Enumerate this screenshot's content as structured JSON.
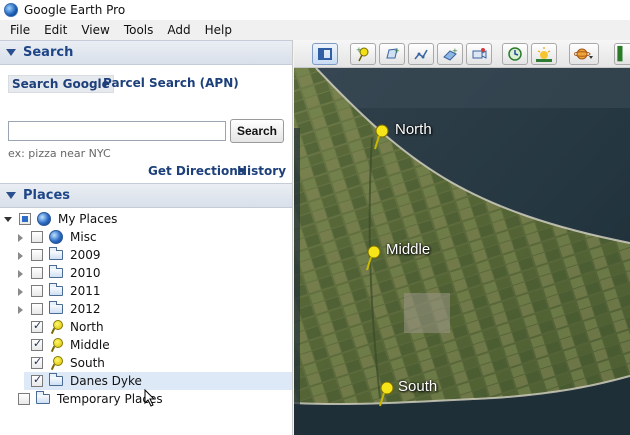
{
  "window": {
    "title": "Google Earth Pro"
  },
  "menu": [
    "File",
    "Edit",
    "View",
    "Tools",
    "Add",
    "Help"
  ],
  "search_panel": {
    "header": "Search",
    "tabs": [
      "Search Google",
      "Parcel Search (APN)"
    ],
    "input_value": "",
    "button_label": "Search",
    "hint": "ex: pizza near NYC",
    "links": {
      "directions": "Get Directions",
      "history": "History"
    }
  },
  "places_panel": {
    "header": "Places",
    "items": [
      {
        "label": "My Places",
        "icon": "globe-icon",
        "checked": "partial",
        "expander": "open",
        "level": 0
      },
      {
        "label": "Misc",
        "icon": "globe-icon",
        "checked": "unchecked",
        "expander": "closed",
        "level": 1
      },
      {
        "label": "2009",
        "icon": "folder-icon",
        "checked": "unchecked",
        "expander": "closed",
        "level": 1
      },
      {
        "label": "2010",
        "icon": "folder-icon",
        "checked": "unchecked",
        "expander": "closed",
        "level": 1
      },
      {
        "label": "2011",
        "icon": "folder-icon",
        "checked": "unchecked",
        "expander": "closed",
        "level": 1
      },
      {
        "label": "2012",
        "icon": "folder-icon",
        "checked": "unchecked",
        "expander": "closed",
        "level": 1
      },
      {
        "label": "North",
        "icon": "placemark-pin-icon",
        "checked": "checked",
        "expander": "none",
        "level": 1
      },
      {
        "label": "Middle",
        "icon": "placemark-pin-icon",
        "checked": "checked",
        "expander": "none",
        "level": 1
      },
      {
        "label": "South",
        "icon": "placemark-pin-icon",
        "checked": "checked",
        "expander": "none",
        "level": 1
      },
      {
        "label": "Danes Dyke",
        "icon": "folder-icon",
        "checked": "checked",
        "expander": "none",
        "level": 1,
        "selected": true
      },
      {
        "label": "Temporary Places",
        "icon": "folder-icon",
        "checked": "unchecked",
        "expander": "none",
        "level": 0
      }
    ]
  },
  "toolbar": {
    "buttons": [
      "sidebar-toggle-icon",
      "add-placemark-icon",
      "add-polygon-icon",
      "add-path-icon",
      "add-image-overlay-icon",
      "record-tour-icon",
      "historical-imagery-icon",
      "sunlight-icon",
      "planets-icon"
    ]
  },
  "map": {
    "placemarks": [
      {
        "label": "North"
      },
      {
        "label": "Middle"
      },
      {
        "label": "South"
      }
    ],
    "colors": {
      "sea": "#2b3a44",
      "land": "#5f6e3f",
      "pin": "#f4e418"
    }
  }
}
